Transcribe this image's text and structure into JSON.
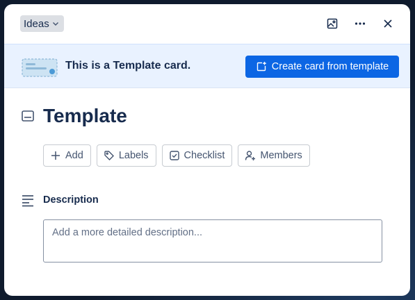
{
  "header": {
    "list_name": "Ideas",
    "icons": [
      "cover-image-icon",
      "more-icon",
      "close-icon"
    ]
  },
  "banner": {
    "message": "This is a Template card.",
    "button_label": "Create card from template",
    "button_color": "#0c66e4",
    "background": "#e9f2ff"
  },
  "card": {
    "title": "Template"
  },
  "actions": [
    {
      "label": "Add",
      "icon": "plus-icon"
    },
    {
      "label": "Labels",
      "icon": "tag-icon"
    },
    {
      "label": "Checklist",
      "icon": "checkbox-icon"
    },
    {
      "label": "Members",
      "icon": "add-member-icon"
    }
  ],
  "description": {
    "label": "Description",
    "placeholder": "Add a more detailed description..."
  }
}
